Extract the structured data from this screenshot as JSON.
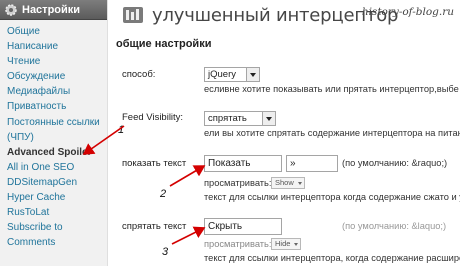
{
  "sidebar": {
    "title": "Настройки",
    "items": [
      {
        "label": "Общие"
      },
      {
        "label": "Написание"
      },
      {
        "label": "Чтение"
      },
      {
        "label": "Обсуждение"
      },
      {
        "label": "Медиафайлы"
      },
      {
        "label": "Приватность"
      },
      {
        "label": "Постоянные ссылки"
      },
      {
        "label": "(ЧПУ)"
      },
      {
        "label": "Advanced Spoiler"
      },
      {
        "label": "All in One SEO"
      },
      {
        "label": "DDSitemapGen"
      },
      {
        "label": "Hyper Cache"
      },
      {
        "label": "RusToLat"
      },
      {
        "label": "Subscribe to"
      },
      {
        "label": "Comments"
      }
    ]
  },
  "header": {
    "title": "улучшенный интерцептор",
    "watermark": "history-of-blog.ru"
  },
  "section": {
    "title": "общие настройки"
  },
  "rows": {
    "method": {
      "label": "способ:",
      "select_value": "jQuery",
      "hint": "есливне хотите показывать или прятать интерцептор,выбе"
    },
    "feed": {
      "label": "Feed Visibility:",
      "select_value": "спрятать",
      "hint": "ели вы хотите спрятать содержание интерцептора на питан"
    },
    "show_text": {
      "label": "показать текст",
      "value": "Показать",
      "suffix_value": "»",
      "default_note": "(по умолчанию: &raquo;)",
      "preview_label": "просматривать:",
      "preview_value": "Show",
      "hint": "текст для ссылки интерцептора когда содержание сжато и ут"
    },
    "hide_text": {
      "label": "спрятать текст",
      "value": "Скрыть",
      "default_note": "(по умолчанию: &laquo;)",
      "preview_label": "просматривать:",
      "preview_value": "Hide",
      "hint": "текст для ссылки интерцептора, когда содержание расширен"
    }
  },
  "annotations": {
    "one": "1",
    "two": "2",
    "three": "3"
  },
  "colors": {
    "link": "#21759b",
    "sidebar_header": "#6b6b6b",
    "arrow": "#d40000"
  }
}
